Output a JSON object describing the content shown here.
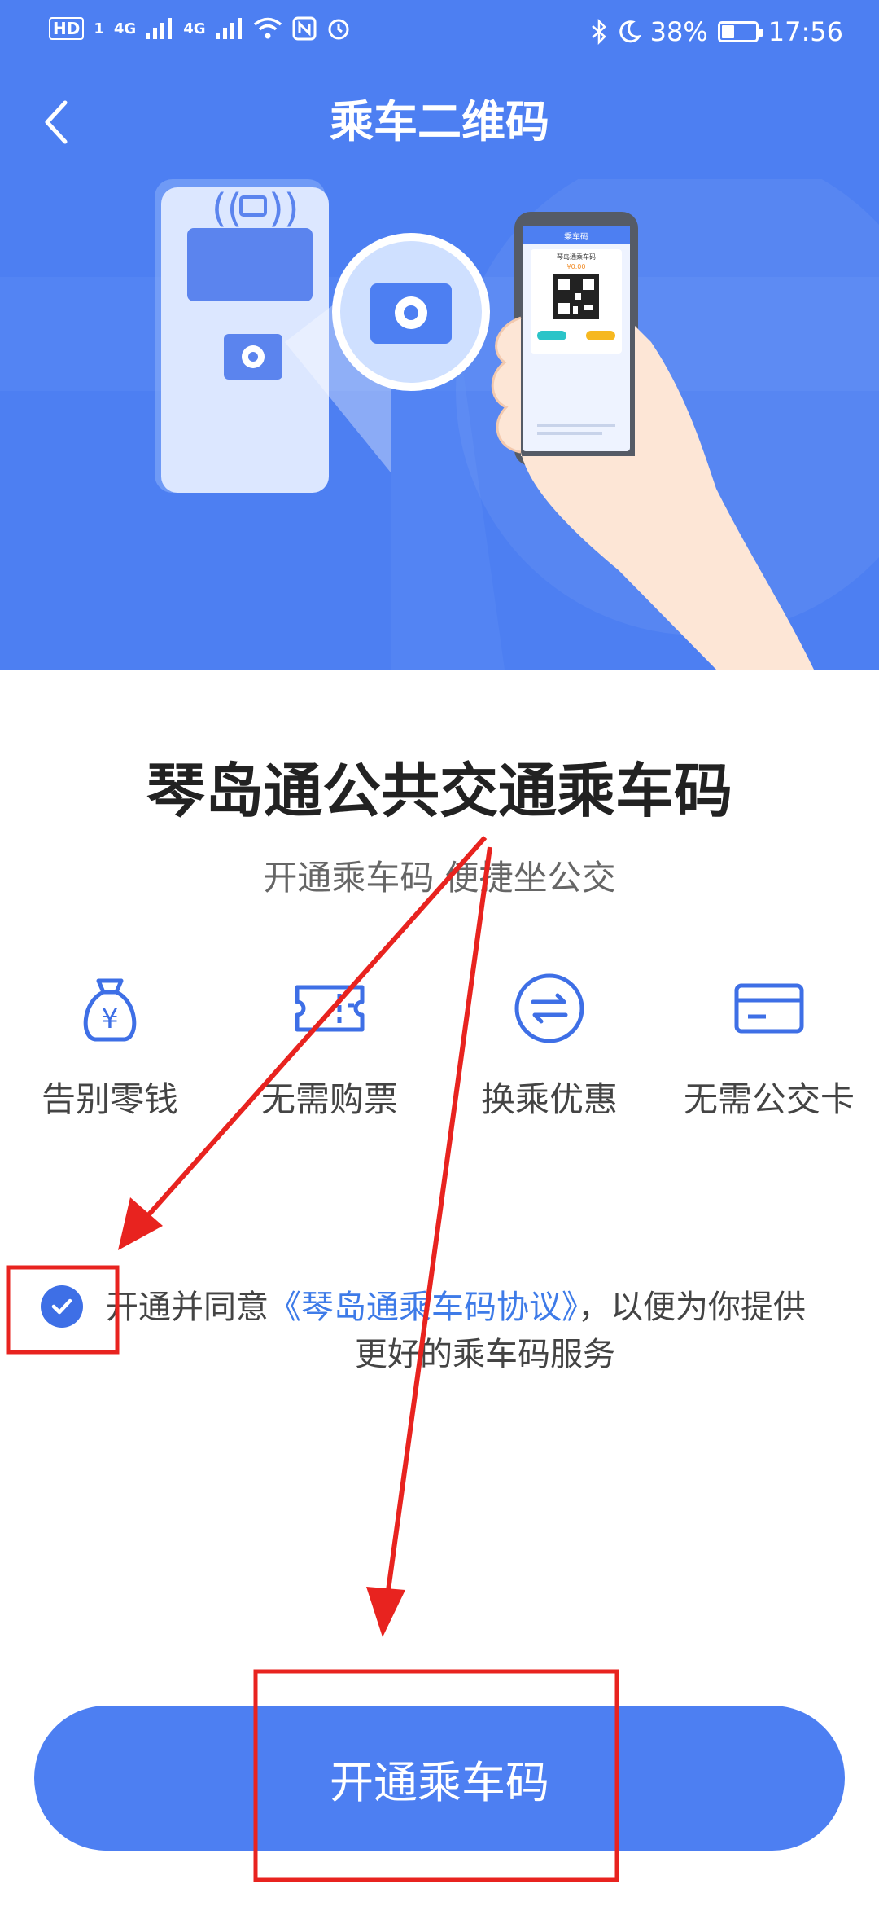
{
  "status_bar": {
    "hd": "HD",
    "sim_slot": "1",
    "network_1": "4G",
    "network_2": "4G",
    "battery_text": "38%",
    "battery_level": 0.38,
    "time": "17:56"
  },
  "nav": {
    "title": "乘车二维码",
    "back_icon": "chevron-left-icon"
  },
  "illustration": {
    "phone_header": "乘车码",
    "phone_card_title": "琴岛通乘车码",
    "phone_amount": "¥0.00"
  },
  "main": {
    "title": "琴岛通公共交通乘车码",
    "subtitle": "开通乘车码 便捷坐公交"
  },
  "features": [
    {
      "label": "告别零钱",
      "icon": "money-bag-icon"
    },
    {
      "label": "无需购票",
      "icon": "ticket-icon"
    },
    {
      "label": "换乘优惠",
      "icon": "transfer-icon"
    },
    {
      "label": "无需公交卡",
      "icon": "card-icon"
    }
  ],
  "agreement": {
    "checked": true,
    "prefix": "开通并同意",
    "link": "《琴岛通乘车码协议》",
    "suffix": "，以便为你提供",
    "line2": "更好的乘车码服务"
  },
  "cta": {
    "label": "开通乘车码"
  },
  "colors": {
    "primary": "#4d7ff2",
    "link": "#3e7be8",
    "annotation_red": "#e8231f"
  }
}
